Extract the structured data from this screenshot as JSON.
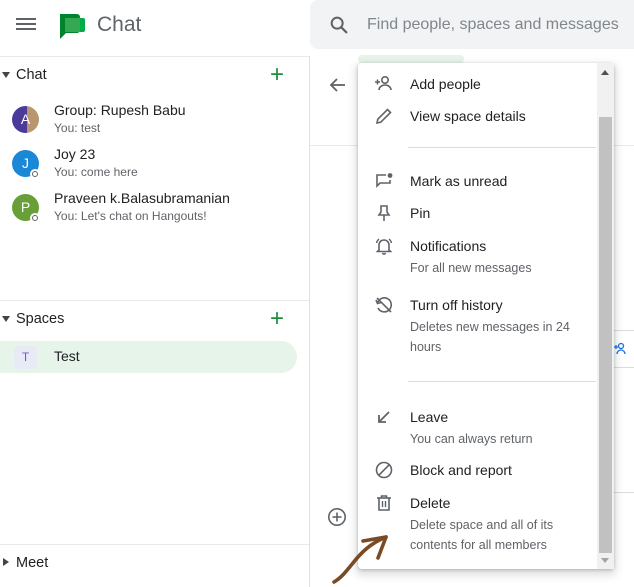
{
  "header": {
    "menu_icon": "hamburger-menu-icon",
    "logo_icon": "google-chat-logo-icon",
    "app_title": "Chat",
    "search": {
      "icon": "search-icon",
      "placeholder": "Find people, spaces and messages"
    }
  },
  "sidebar": {
    "chat_section": {
      "label": "Chat",
      "add_icon": "plus-icon",
      "items": [
        {
          "name": "Group: Rupesh Babu",
          "preview": "You: test",
          "avatar_letter": "A",
          "avatar_color": "#5c3c9c"
        },
        {
          "name": "Joy 23",
          "preview": "You: come here",
          "avatar_letter": "J",
          "avatar_color": "#1a88d6"
        },
        {
          "name": "Praveen k.Balasubramanian",
          "preview": "You: Let's chat on Hangouts!",
          "avatar_letter": "P",
          "avatar_color": "#689f38"
        }
      ]
    },
    "spaces_section": {
      "label": "Spaces",
      "add_icon": "plus-icon",
      "items": [
        {
          "name": "Test",
          "avatar_letter": "T"
        }
      ]
    },
    "meet_section": {
      "label": "Meet"
    }
  },
  "context_menu": {
    "items": [
      {
        "label": "Add people",
        "icon": "add-person-icon"
      },
      {
        "label": "View space details",
        "icon": "pencil-icon"
      },
      {
        "label": "Mark as unread",
        "icon": "mark-unread-icon"
      },
      {
        "label": "Pin",
        "icon": "pin-icon"
      },
      {
        "label": "Notifications",
        "description": "For all new messages",
        "icon": "bell-icon"
      },
      {
        "label": "Turn off history",
        "description": "Deletes new messages in 24 hours",
        "icon": "history-off-icon"
      },
      {
        "label": "Leave",
        "description": "You can always return",
        "icon": "leave-arrow-icon"
      },
      {
        "label": "Block and report",
        "icon": "block-icon"
      },
      {
        "label": "Delete",
        "description": "Delete space and all of its contents for all members",
        "icon": "trash-icon"
      }
    ]
  },
  "colors": {
    "accent_green": "#1e8e3e",
    "selected_bg": "#e6f4ea",
    "annotation_brown": "#7a4a24"
  }
}
